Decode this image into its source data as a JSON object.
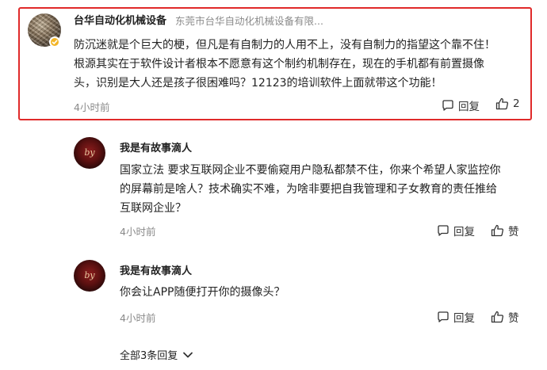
{
  "main_comment": {
    "username": "台华自动化机械设备",
    "company": "东莞市台华自动化机械设备有限...",
    "lines": [
      "防沉迷就是个巨大的梗，但凡是有自制力的人用不上，没有自制力的指望这个靠不住！",
      "根源其实在于软件设计者根本不愿意有这个制约机制存在，现在的手机都有前置摄像",
      "头，识别是大人还是孩子很困难吗？12123的培训软件上面就带这个功能！"
    ],
    "time": "4小时前",
    "reply_label": "回复",
    "like_count": "2"
  },
  "replies": [
    {
      "username": "我是有故事滴人",
      "lines": [
        "国家立法 要求互联网企业不要偷窥用户隐私都禁不住，你来个希望人家监控你",
        "的屏幕前是啥人？技术确实不难，为啥非要把自我管理和子女教育的责任推给",
        "互联网企业？"
      ],
      "time": "4小时前",
      "reply_label": "回复",
      "like_label": "赞"
    },
    {
      "username": "我是有故事滴人",
      "lines": [
        "你会让APP随便打开你的摄像头？"
      ],
      "time": "4小时前",
      "reply_label": "回复",
      "like_label": "赞"
    }
  ],
  "more_replies_label": "全部3条回复",
  "colors": {
    "highlight_border": "#e02a2a",
    "badge": "#f3b527",
    "muted_text": "#8a8a8a"
  },
  "icons": {
    "reply": "comment-bubble-icon",
    "like": "thumbs-up-icon",
    "expand": "chevron-down-icon",
    "verified": "verified-badge-icon"
  }
}
